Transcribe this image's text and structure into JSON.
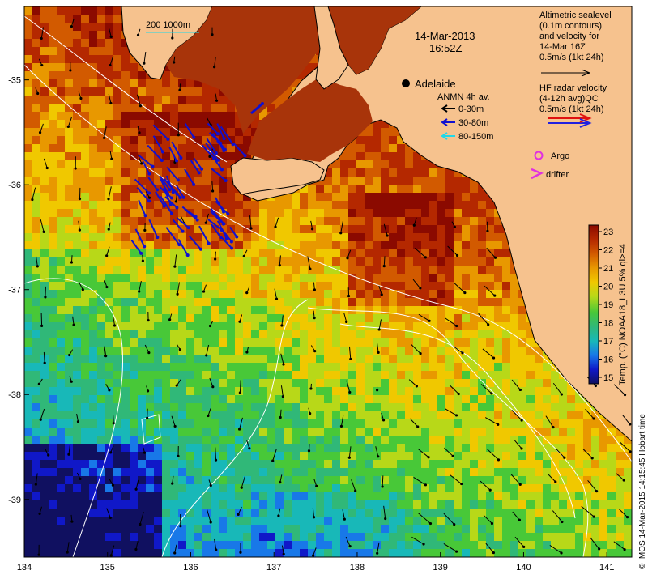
{
  "map": {
    "lon_ticks": [
      "134",
      "135",
      "136",
      "137",
      "138",
      "139",
      "140",
      "141"
    ],
    "lat_ticks": [
      "-35",
      "-36",
      "-37",
      "-38",
      "-39"
    ],
    "lon_range": [
      134,
      141.3
    ],
    "lat_range": [
      -39.55,
      -34.3
    ],
    "date_line1": "14-Mar-2013",
    "date_line2": "16:52Z",
    "city": "Adelaide",
    "scale_bar": "200  1000m"
  },
  "legend": {
    "altimetry": [
      "Altimetric sealevel",
      "(0.1m contours)",
      "and velocity for",
      "14-Mar 16Z",
      "0.5m/s (1kt 24h)"
    ],
    "hf_radar": [
      "HF radar velocity",
      "(4-12h avg)QC",
      "0.5m/s (1kt 24h)"
    ],
    "anmn_title": "ANMN 4h av.",
    "anmn_items": [
      {
        "label": "0-30m",
        "color": "#000000"
      },
      {
        "label": "30-80m",
        "color": "#1010d0"
      },
      {
        "label": "80-150m",
        "color": "#20d8e8"
      }
    ],
    "argo": "Argo",
    "drifter": "drifter",
    "argo_color": "#e030e0",
    "hf_colors": [
      "#e01010",
      "#2020e0"
    ]
  },
  "colorbar": {
    "ticks": [
      "23",
      "22",
      "21",
      "20",
      "19",
      "18",
      "17",
      "16",
      "15"
    ],
    "label": "Temp. (°C) NOAA18_L3U 5% ql>=4",
    "colors": [
      "#8b0a00",
      "#b42800",
      "#d25a00",
      "#e89800",
      "#f0c800",
      "#b8d818",
      "#48c838",
      "#30b878",
      "#18b8b8",
      "#1878e8",
      "#1018c8",
      "#101060"
    ]
  },
  "credit": "© IMOS 14-Mar-2015 14:15:45 Hobart time",
  "colors": {
    "land": "#f6c28e",
    "coast": "#000000",
    "contour": "#ffffff"
  }
}
